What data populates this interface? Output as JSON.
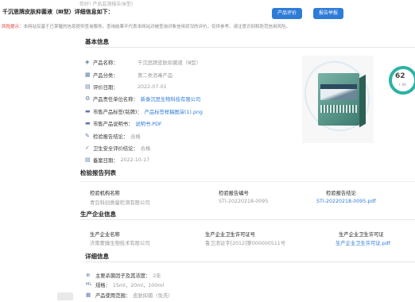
{
  "header": {
    "faint_text": "你好! 产品监测报告(Ⅲ型)",
    "title": "千沉思牌皮肤抑菌液（Ⅲ型）详细信息如下：",
    "btn_eval": "产品评价",
    "btn_report": "报告举报"
  },
  "risk": {
    "label": "风险提示：",
    "text": "本网站仅基于已掌握的信息提供查询服务，查询结果不代表本网站对被查询对象信用状况的评价，仅供参考。请注意识别和防范信用风险。"
  },
  "basic": {
    "heading": "基本信息",
    "rows": [
      {
        "icon": "◈",
        "label": "产品名称：",
        "value": "千沉思牌皮肤抑菌液（Ⅲ型）"
      },
      {
        "icon": "▦",
        "label": "产品分类：",
        "value": "第二类消毒产品"
      },
      {
        "icon": "▤",
        "label": "评价日期：",
        "value": "2022-07-01"
      },
      {
        "icon": "⚙",
        "label": "产品责任单位名称：",
        "value": "新泰沉思生物科技有限公司"
      },
      {
        "icon": "▬",
        "label": "市售产品标签(铭牌)：",
        "value": "产品标签样稿图演(1).png"
      },
      {
        "icon": "▬",
        "label": "市售产品说明书：",
        "value": "说明书.PDF"
      },
      {
        "icon": "✎",
        "label": "检验报告结论：",
        "value": "合格"
      },
      {
        "icon": "✓",
        "label": "卫生安全评价结论：",
        "value": "合格"
      },
      {
        "icon": "▤",
        "label": "备案日期：",
        "value": "2022-10-17"
      }
    ],
    "score": "62",
    "score_sub": "↑ 00"
  },
  "inspection": {
    "heading": "检验报告列表",
    "col1": "检验机构名称",
    "col2": "检验报告编号",
    "col3": "检验报告结论",
    "v1": "青岛科创质量检测有限公司",
    "v2": "STI-20220218-0095",
    "v3": "STI-20220218-0095.pdf"
  },
  "enterprise": {
    "heading": "生产企业信息",
    "col1": "生产企业名称",
    "col2": "生产企业卫生许可证号",
    "col3": "生产企业卫生许可证",
    "v1": "济南蒙臻生物技术有限公司",
    "v2": "鲁卫消证字[2012]第000000511号",
    "v3": "生产企业卫生许可证.pdf"
  },
  "details": {
    "heading": "详细信息",
    "rows": [
      {
        "icon": "⊕",
        "label": "主要杀菌因子及其浓度：",
        "value": "2年"
      },
      {
        "icon": "ML",
        "label": "规格：",
        "value": "15ml，20ml，100ml"
      },
      {
        "icon": "▦",
        "label": "产品使用范围：",
        "value": "皮肤抑菌（免洗）"
      }
    ]
  }
}
